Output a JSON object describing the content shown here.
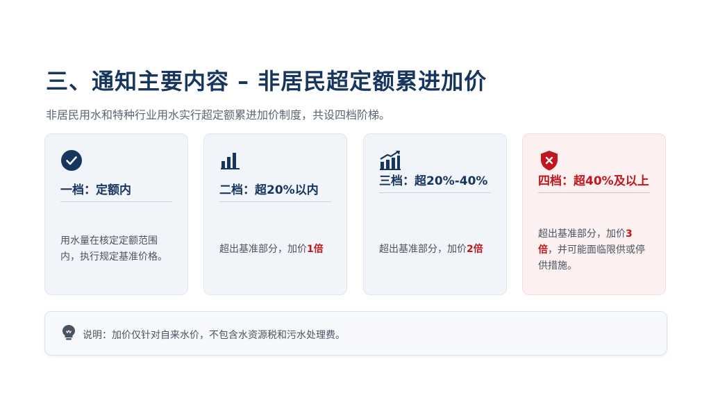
{
  "header": {
    "title": "三、通知主要内容 – 非居民超定额累进加价",
    "subtitle": "非居民用水和特种行业用水实行超定额累进加价制度，共设四档阶梯。"
  },
  "tiers": [
    {
      "icon": "check-circle-icon",
      "label": "一档：定额内",
      "desc": "用水量在核定定额范围内，执行规定基准价格。",
      "desc_suffix": "",
      "highlight": ""
    },
    {
      "icon": "bar-chart-icon",
      "label": "二档：超20%以内",
      "desc": "超出基准部分，加价",
      "highlight": "1倍",
      "desc_suffix": ""
    },
    {
      "icon": "trending-up-chart-icon",
      "label": "三档：超20%-40%",
      "desc": "超出基准部分，加价",
      "highlight": "2倍",
      "desc_suffix": ""
    },
    {
      "icon": "shield-x-icon",
      "label": "四档：超40%及以上",
      "desc": "超出基准部分，加价",
      "highlight": "3倍",
      "desc_suffix": "，并可能面临限供或停供措施。"
    }
  ],
  "note": {
    "icon": "lightbulb-icon",
    "text": "说明：加价仅针对自来水价，不包含水资源税和污水处理费。"
  },
  "colors": {
    "primary": "#17365f",
    "alert": "#c0161d",
    "card_bg": "#f1f4f8",
    "alert_bg": "#fcf0f1"
  }
}
